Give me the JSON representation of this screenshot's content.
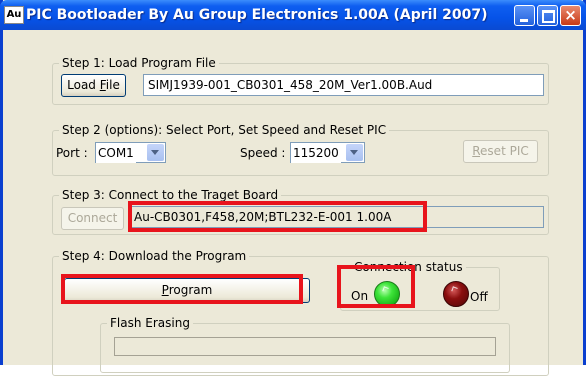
{
  "window": {
    "icon_text": "Au",
    "title": "PIC Bootloader By Au Group Electronics 1.00A (April 2007)"
  },
  "step1": {
    "legend": "Step 1: Load Program File",
    "load_button": {
      "pre": "Load ",
      "mnemonic": "F",
      "post": "ile"
    },
    "file_path": "SIMJ1939-001_CB0301_458_20M_Ver1.00B.Aud"
  },
  "step2": {
    "legend": "Step 2 (options): Select Port, Set Speed and Reset PIC",
    "port_label": "Port :",
    "port_value": "COM1",
    "speed_label": "Speed :",
    "speed_value": "115200",
    "reset_button": {
      "mnemonic": "R",
      "post": "eset PIC"
    }
  },
  "step3": {
    "legend": "Step 3: Connect to the Traget Board",
    "connect_button": "Connect",
    "board_info": "Au-CB0301,F458,20M;BTL232-E-001 1.00A"
  },
  "step4": {
    "legend": "Step 4: Download the Program",
    "program_button": {
      "mnemonic": "P",
      "post": "rogram"
    },
    "connection_status": {
      "legend": "Connection status",
      "on_label": "On",
      "off_label": "Off",
      "state": "on"
    },
    "flash": {
      "legend": "Flash Erasing",
      "progress": 0
    }
  },
  "colors": {
    "highlight": "#e8141c",
    "led_on": "#3ee43a",
    "led_off": "#8a0e0e",
    "titlebar": "#0653e8"
  }
}
